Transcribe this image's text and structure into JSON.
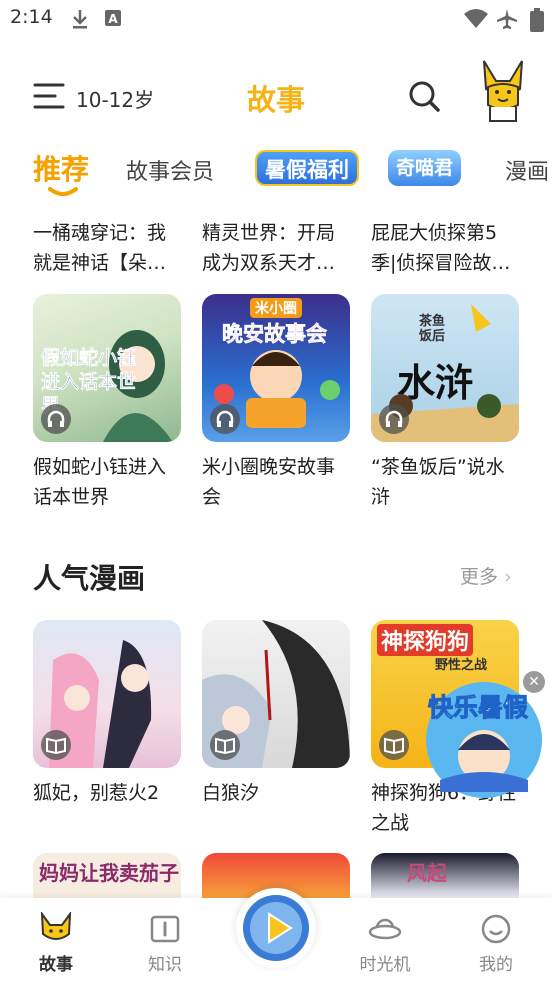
{
  "status_bar": {
    "time": "2:14"
  },
  "header": {
    "age": "10-12岁",
    "title": "故事"
  },
  "tabs": [
    {
      "label": "推荐"
    },
    {
      "label": "故事会员"
    },
    {
      "label": "暑假福利"
    },
    {
      "label": "奇喵君"
    },
    {
      "label": "漫画"
    }
  ],
  "top_row_titles": [
    "一桶魂穿记：我就是神话【朵…",
    "精灵世界：开局成为双系天才…",
    "屁屁大侦探第5季|侦探冒险故…"
  ],
  "story_cards": [
    {
      "title": "假如蛇小钰进入话本世界",
      "cover_text": "假如蛇小钰进入话本世界"
    },
    {
      "title": "米小圈晚安故事会",
      "cover_text_top": "米小圈",
      "cover_text": "晚安故事会"
    },
    {
      "title": "“茶鱼饭后”说水浒",
      "cover_text_top": "茶鱼饭后",
      "cover_text": "水浒"
    }
  ],
  "comics_section": {
    "title": "人气漫画",
    "more": "更多"
  },
  "comic_cards": [
    {
      "title": "狐妃，别惹火2"
    },
    {
      "title": "白狼汐"
    },
    {
      "title": "神探狗狗6：野性之战",
      "cover_text_top": "神探狗狗",
      "cover_text": "野性之战"
    }
  ],
  "partial_covers": [
    {
      "text": "妈妈让我卖茄子"
    },
    {
      "text": ""
    },
    {
      "text": "风起"
    }
  ],
  "float_banner": {
    "text": "快乐暑假"
  },
  "bottom_nav": [
    {
      "label": "故事"
    },
    {
      "label": "知识"
    },
    {
      "label": "时光机"
    },
    {
      "label": "我的"
    }
  ],
  "colors": {
    "accent": "#f5b316",
    "active_tab": "#f5a100",
    "text": "#222222",
    "muted": "#888888"
  }
}
